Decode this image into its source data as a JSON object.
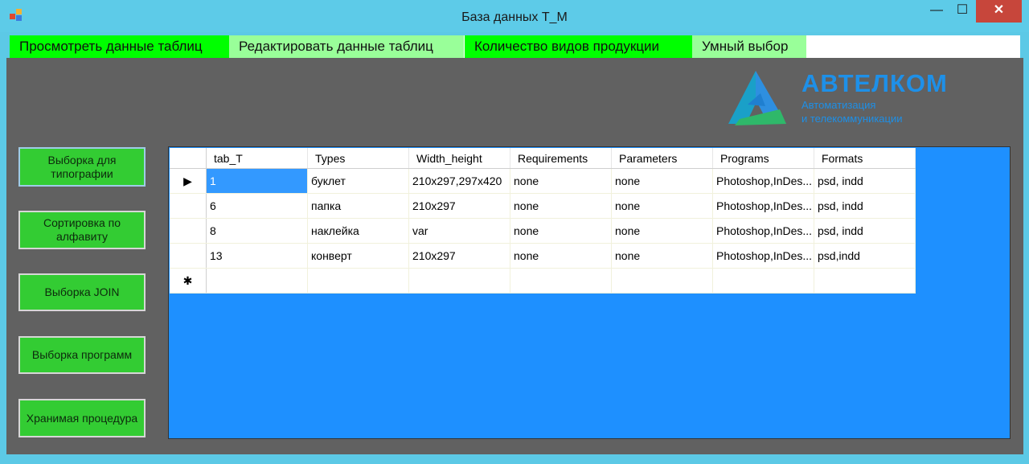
{
  "window": {
    "title": "База данных T_M",
    "close_glyph": "✕",
    "min_glyph": "—",
    "max_glyph": "☐"
  },
  "menu": [
    {
      "label": "Просмотреть данные таблиц",
      "color": "#00ff00"
    },
    {
      "label": "Редактировать данные таблиц",
      "color": "#99ff99"
    },
    {
      "label": "Количество видов продукции",
      "color": "#00ff00"
    },
    {
      "label": "Умный выбор",
      "color": "#99ff99"
    }
  ],
  "logo": {
    "name": "АВТЕЛКОМ",
    "sub1": "Автоматизация",
    "sub2": "и телекоммуникации"
  },
  "side_buttons": [
    "Выборка для типографии",
    "Сортировка по алфавиту",
    "Выборка JOIN",
    "Выборка программ",
    "Хранимая процедура"
  ],
  "grid": {
    "columns": [
      "tab_T",
      "Types",
      "Width_height",
      "Requirements",
      "Parameters",
      "Programs",
      "Formats"
    ],
    "rows": [
      [
        "1",
        "буклет",
        "210x297,297x420",
        "none",
        "none",
        "Photoshop,InDes...",
        "psd, indd"
      ],
      [
        "6",
        "папка",
        "210x297",
        "none",
        "none",
        "Photoshop,InDes...",
        "psd, indd"
      ],
      [
        "8",
        "наклейка",
        "var",
        "none",
        "none",
        "Photoshop,InDes...",
        "psd, indd"
      ],
      [
        "13",
        "конверт",
        "210x297",
        "none",
        "none",
        "Photoshop,InDes...",
        "psd,indd"
      ]
    ],
    "current_row_glyph": "▶",
    "new_row_glyph": "✱"
  },
  "colors": {
    "accent": "#1e90ff",
    "button": "#33cc33",
    "selection": "#3399ff"
  }
}
